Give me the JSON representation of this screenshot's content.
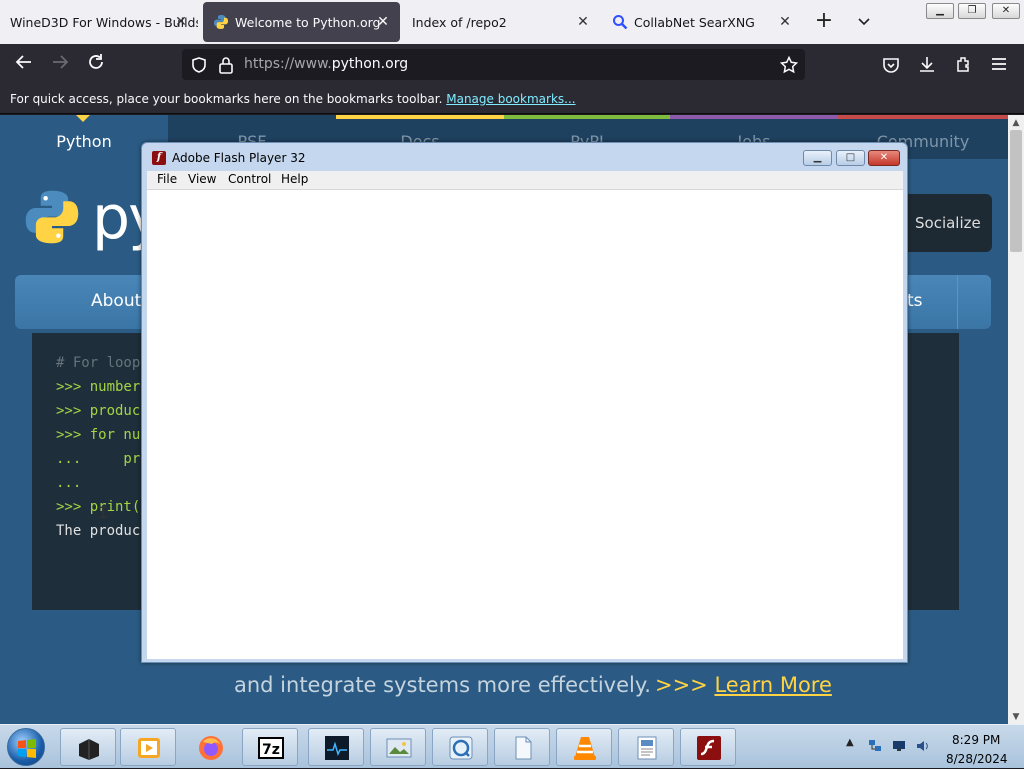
{
  "browser": {
    "tabs": [
      {
        "label": "WineD3D For Windows - Builds",
        "icon": "page-icon",
        "active": false
      },
      {
        "label": "Welcome to Python.org",
        "icon": "python-icon",
        "active": true
      },
      {
        "label": "Index of /repo2",
        "icon": "none",
        "active": false
      },
      {
        "label": "CollabNet SearXNG",
        "icon": "search-icon",
        "active": false
      }
    ],
    "tab_close_glyph": "✕",
    "new_tab_glyph": "+",
    "list_tabs_glyph": "⌄",
    "url": {
      "prefix": "https://www.",
      "domain": "python.org"
    },
    "bookmarks_message": "For quick access, place your bookmarks here on the bookmarks toolbar.",
    "bookmarks_link": "Manage bookmarks..."
  },
  "python_site": {
    "top_nav": [
      "Python",
      "PSF",
      "Docs",
      "PyPI",
      "Jobs",
      "Community"
    ],
    "top_nav_colors": [
      "#2b5b84",
      "#1e415f",
      "#ffd343",
      "#7fbb3d",
      "#8c5aa8",
      "#c54a4a"
    ],
    "logo_text_fragment": "py",
    "socialize_label": "Socialize",
    "main_nav_about": "About",
    "main_nav_events_fragment": "ts",
    "code_lines": [
      {
        "text": "# For loop",
        "style": "cmt"
      },
      {
        "text": ">>> number",
        "style": "grn"
      },
      {
        "text": ">>> produc",
        "style": "grn"
      },
      {
        "text": ">>> for nu",
        "style": "grn"
      },
      {
        "text": "...     pro",
        "style": "grn"
      },
      {
        "text": "...",
        "style": "grn"
      },
      {
        "text": ">>> print(",
        "style": "grn"
      },
      {
        "text": "The produc",
        "style": "wht"
      }
    ],
    "tagline": "and integrate systems more effectively.",
    "tagline_arrows": ">>>",
    "learn_more": "Learn More"
  },
  "flash_window": {
    "title": "Adobe Flash Player 32",
    "menu": [
      "File",
      "View",
      "Control",
      "Help"
    ],
    "buttons": {
      "minimize": "▁",
      "maximize": "□",
      "close": "✕"
    }
  },
  "taskbar": {
    "items": [
      "wine-app-icon",
      "media-player-icon",
      "firefox-icon",
      "7zip-icon",
      "monitor-app-icon",
      "image-viewer-icon",
      "browser-app-icon",
      "file-icon",
      "vlc-icon",
      "document-icon",
      "flash-player-icon"
    ],
    "clock_time": "8:29 PM",
    "clock_date": "8/28/2024"
  }
}
